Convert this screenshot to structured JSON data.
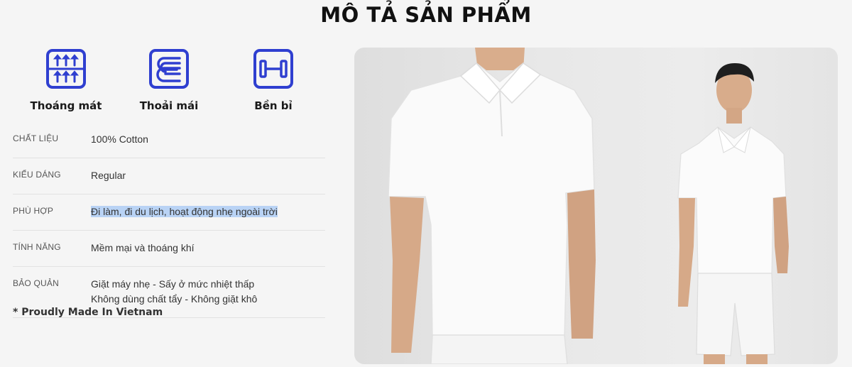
{
  "section_title": "MÔ TẢ SẢN PHẨM",
  "features": [
    {
      "icon": "ventilation-arrows-icon",
      "label": "Thoáng mát"
    },
    {
      "icon": "fabric-roll-icon",
      "label": "Thoải mái"
    },
    {
      "icon": "durability-bar-icon",
      "label": "Bền bỉ"
    }
  ],
  "specs": [
    {
      "key": "CHẤT LIỆU",
      "value": "100% Cotton"
    },
    {
      "key": "KIỂU DÁNG",
      "value": "Regular"
    },
    {
      "key": "PHÙ HỢP",
      "value": "Đi làm, đi du lịch, hoạt động nhẹ ngoài trời"
    },
    {
      "key": "TÍNH NĂNG",
      "value": "Mềm mại và thoáng khí"
    },
    {
      "key": "BẢO QUẢN",
      "lines": [
        "Giặt máy nhẹ - Sấy ở mức nhiệt thấp",
        "Không dùng chất tẩy - Không giặt khô"
      ]
    }
  ],
  "made_in": "* Proudly Made In Vietnam",
  "colors": {
    "icon_blue": "#2f3fd0",
    "highlight": "#b9d3f5",
    "background": "#f5f5f5"
  }
}
